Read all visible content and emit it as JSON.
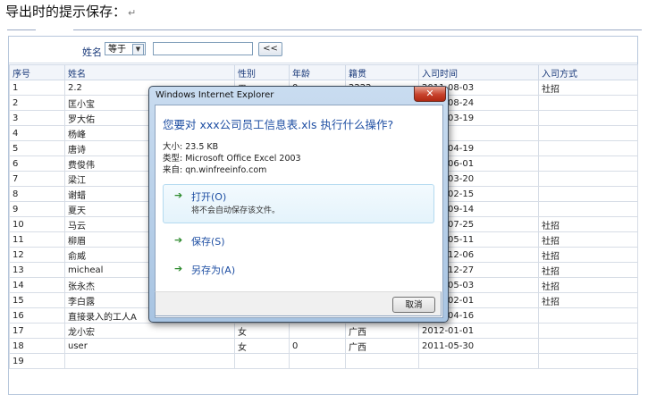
{
  "doc": {
    "title": "导出时的提示保存：",
    "para_mark": "↵"
  },
  "filter": {
    "label": "姓名",
    "operator": "等于",
    "arrow": "▼",
    "value": "",
    "button": "<<"
  },
  "table": {
    "headers": [
      "序号",
      "姓名",
      "性别",
      "年龄",
      "籍贯",
      "入司时间",
      "入司方式"
    ],
    "rows": [
      [
        "1",
        "2.2",
        "男",
        "0",
        "2222",
        "2011-08-03",
        "社招"
      ],
      [
        "2",
        "匡小宝",
        "",
        "",
        "",
        "2011-08-24",
        ""
      ],
      [
        "3",
        "罗大佑",
        "",
        "",
        "",
        "2011-03-19",
        ""
      ],
      [
        "4",
        "杨峰",
        "",
        "",
        "",
        "",
        ""
      ],
      [
        "5",
        "唐诗",
        "",
        "",
        "",
        "2011-04-19",
        ""
      ],
      [
        "6",
        "费俊伟",
        "",
        "",
        "",
        "2011-06-01",
        ""
      ],
      [
        "7",
        "梁江",
        "",
        "",
        "",
        "2011-03-20",
        ""
      ],
      [
        "8",
        "谢蜡",
        "",
        "",
        "",
        "2011-02-15",
        ""
      ],
      [
        "9",
        "夏天",
        "",
        "",
        "",
        "2011-09-14",
        ""
      ],
      [
        "10",
        "马云",
        "",
        "",
        "",
        "2011-07-25",
        "社招"
      ],
      [
        "11",
        "柳眉",
        "",
        "",
        "",
        "2011-05-11",
        "社招"
      ],
      [
        "12",
        "俞威",
        "",
        "",
        "",
        "2011-12-06",
        "社招"
      ],
      [
        "13",
        "micheal",
        "",
        "",
        "",
        "2011-12-27",
        "社招"
      ],
      [
        "14",
        "张永杰",
        "",
        "",
        "",
        "2011-05-03",
        "社招"
      ],
      [
        "15",
        "李白露",
        "",
        "",
        "",
        "2011-02-01",
        "社招"
      ],
      [
        "16",
        "直接录入的工人A",
        "女",
        "",
        "广西",
        "2012-04-16",
        ""
      ],
      [
        "17",
        "龙小宏",
        "女",
        "",
        "广西",
        "2012-01-01",
        ""
      ],
      [
        "18",
        "user",
        "女",
        "0",
        "广西",
        "2011-05-30",
        ""
      ],
      [
        "19",
        "",
        "",
        "",
        "",
        "",
        ""
      ]
    ]
  },
  "dialog": {
    "title": "Windows Internet Explorer",
    "close": "✕",
    "question": "您要对 xxx公司员工信息表.xls 执行什么操作?",
    "size": "大小: 23.5 KB",
    "type": "类型: Microsoft Office Excel 2003",
    "from": "来自: qn.winfreeinfo.com",
    "open_label": "打开(O)",
    "open_sub": "将不会自动保存该文件。",
    "save_label": "保存(S)",
    "saveas_label": "另存为(A)",
    "cancel_label": "取消",
    "arrow": "➔"
  },
  "colors": {
    "accent": "#1f4fa3",
    "header_text": "#1a3a7a",
    "close_red": "#c7422c",
    "arrow_green": "#2e8b2e"
  }
}
